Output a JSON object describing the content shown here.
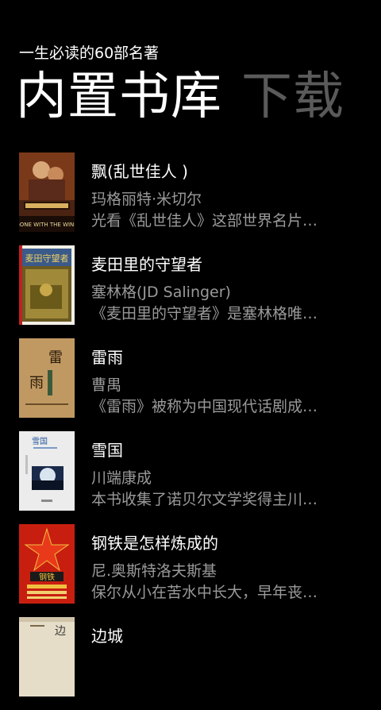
{
  "app": {
    "title": "一生必读的60部名著"
  },
  "pivot": {
    "active_label": "内置书库",
    "next_label": "下载"
  },
  "books": [
    {
      "title": "飘(乱世佳人 )",
      "author": "玛格丽特·米切尔",
      "desc": "光看《乱世佳人》这部世界名片…",
      "cover_text": "GONE WITH THE WIND",
      "cover_color": "#5a2a14"
    },
    {
      "title": "麦田里的守望者",
      "author": "塞林格(JD Salinger)",
      "desc": "《麦田里的守望者》是塞林格唯…",
      "cover_text": "麦田守望者",
      "cover_color": "#7a6a2a"
    },
    {
      "title": "雷雨",
      "author": "曹禺",
      "desc": "《雷雨》被称为中国现代话剧成…",
      "cover_text": "雷雨",
      "cover_color": "#b89560"
    },
    {
      "title": "雪国",
      "author": "川端康成",
      "desc": "本书收集了诺贝尔文学奖得主川…",
      "cover_text": "雪国",
      "cover_color": "#e8e8e8"
    },
    {
      "title": "钢铁是怎样炼成的",
      "author": "尼.奥斯特洛夫斯基",
      "desc": "保尔从小在苦水中长大，早年丧…",
      "cover_text": "钢铁",
      "cover_color": "#c81e10"
    },
    {
      "title": "边城",
      "author": "",
      "desc": "",
      "cover_text": "边",
      "cover_color": "#e6ddc8"
    }
  ]
}
